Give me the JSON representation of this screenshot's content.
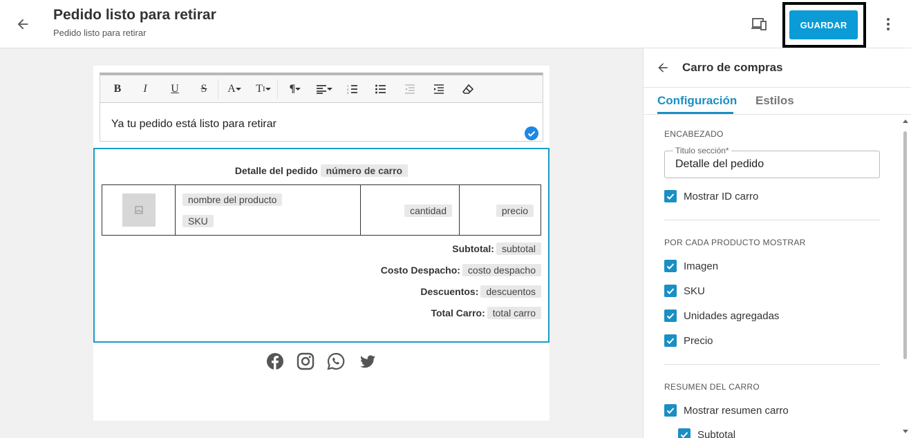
{
  "header": {
    "title": "Pedido listo para retirar",
    "subtitle": "Pedido listo para retirar",
    "save_label": "GUARDAR"
  },
  "editor": {
    "toolbar": {
      "bold": "B",
      "italic": "I",
      "underline": "U",
      "strike": "S",
      "font_color": "A",
      "font_size": "T",
      "paragraph": "¶"
    },
    "text": "Ya tu pedido está listo para retirar"
  },
  "cart": {
    "title": "Detalle del pedido",
    "title_tag": "número de carro",
    "product_name_tag": "nombre del producto",
    "sku_tag": "SKU",
    "quantity_tag": "cantidad",
    "price_tag": "precio",
    "summary": [
      {
        "label": "Subtotal:",
        "tag": "subtotal"
      },
      {
        "label": "Costo Despacho:",
        "tag": "costo despacho"
      },
      {
        "label": "Descuentos:",
        "tag": "descuentos"
      },
      {
        "label": "Total Carro:",
        "tag": "total carro"
      }
    ]
  },
  "social_icons": [
    "facebook-icon",
    "instagram-icon",
    "whatsapp-icon",
    "twitter-icon"
  ],
  "panel": {
    "title": "Carro de compras",
    "tabs": [
      {
        "label": "Configuración",
        "active": true
      },
      {
        "label": "Estilos",
        "active": false
      }
    ],
    "header_section": {
      "label": "ENCABEZADO",
      "field_legend": "Titulo sección*",
      "field_value": "Detalle del pedido",
      "show_cart_id": "Mostrar ID carro"
    },
    "product_section": {
      "label": "POR CADA PRODUCTO MOSTRAR",
      "options": [
        "Imagen",
        "SKU",
        "Unidades agregadas",
        "Precio"
      ]
    },
    "summary_section": {
      "label": "RESUMEN DEL CARRO",
      "show_summary": "Mostrar resumen carro",
      "subtotal": "Subtotal"
    }
  },
  "colors": {
    "accent": "#0b9bd6",
    "tab_active": "#1a8fc4",
    "cart_border": "#1a9bc8",
    "checkbox": "#1a8fc4"
  }
}
